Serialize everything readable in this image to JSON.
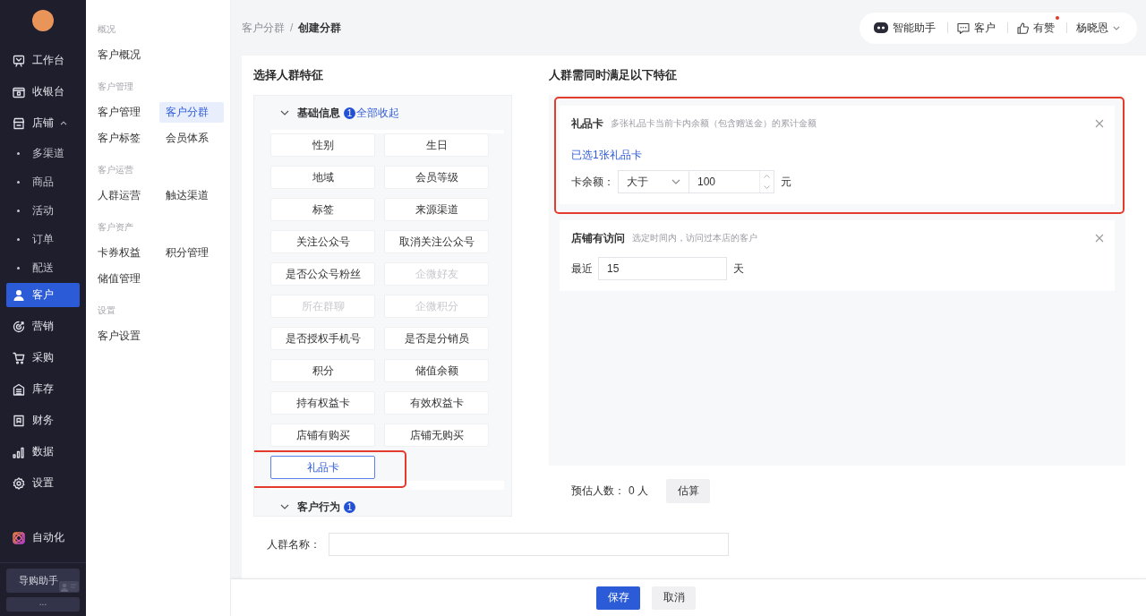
{
  "sidebar": {
    "items": [
      {
        "label": "工作台",
        "selected": false
      },
      {
        "label": "收银台",
        "selected": false
      },
      {
        "label": "店铺",
        "selected": false,
        "expanded": true,
        "children": [
          {
            "label": "多渠道",
            "selected": false
          },
          {
            "label": "商品",
            "selected": false
          },
          {
            "label": "活动",
            "selected": false
          },
          {
            "label": "订单",
            "selected": false
          },
          {
            "label": "配送",
            "selected": false
          }
        ]
      },
      {
        "label": "客户",
        "selected": true
      },
      {
        "label": "营销",
        "selected": false
      },
      {
        "label": "采购",
        "selected": false
      },
      {
        "label": "库存",
        "selected": false
      },
      {
        "label": "财务",
        "selected": false
      },
      {
        "label": "数据",
        "selected": false
      },
      {
        "label": "设置",
        "selected": false
      }
    ],
    "automation": {
      "label": "自动化"
    },
    "assistant_button": "导购助手",
    "more_button": "..."
  },
  "subnav": {
    "sections": [
      {
        "heading": "概况",
        "items": [
          {
            "label": "客户概况",
            "selected": false
          }
        ]
      },
      {
        "heading": "客户管理",
        "items": [
          {
            "label": "客户管理",
            "selected": false
          },
          {
            "label": "客户分群",
            "selected": true
          },
          {
            "label": "客户标签",
            "selected": false
          },
          {
            "label": "会员体系",
            "selected": false
          }
        ]
      },
      {
        "heading": "客户运营",
        "items": [
          {
            "label": "人群运营",
            "selected": false
          },
          {
            "label": "触达渠道",
            "selected": false
          }
        ]
      },
      {
        "heading": "客户资产",
        "items": [
          {
            "label": "卡券权益",
            "selected": false
          },
          {
            "label": "积分管理",
            "selected": false
          },
          {
            "label": "储值管理",
            "selected": false
          }
        ]
      },
      {
        "heading": "设置",
        "items": [
          {
            "label": "客户设置",
            "selected": false
          }
        ]
      }
    ]
  },
  "breadcrumb": {
    "items": [
      "客户分群",
      "创建分群"
    ],
    "separator": "/"
  },
  "topbar": {
    "items": [
      {
        "kind": "assistant",
        "label": "智能助手",
        "badge_dot": false
      },
      {
        "kind": "message",
        "label": "客户",
        "badge_dot": false
      },
      {
        "kind": "like",
        "label": "有赞",
        "badge_dot": true
      },
      {
        "kind": "user",
        "label": "杨晓恩",
        "badge_dot": false
      }
    ]
  },
  "feature_picker": {
    "title": "选择人群特征",
    "groups": [
      {
        "label": "基础信息",
        "count": "1",
        "action": "全部收起",
        "options": [
          {
            "label": "性别",
            "selected": false,
            "disabled": false,
            "highlighted": false
          },
          {
            "label": "生日",
            "selected": false,
            "disabled": false,
            "highlighted": false
          },
          {
            "label": "地域",
            "selected": false,
            "disabled": false,
            "highlighted": false
          },
          {
            "label": "会员等级",
            "selected": false,
            "disabled": false,
            "highlighted": false
          },
          {
            "label": "标签",
            "selected": false,
            "disabled": false,
            "highlighted": false
          },
          {
            "label": "来源渠道",
            "selected": false,
            "disabled": false,
            "highlighted": false
          },
          {
            "label": "关注公众号",
            "selected": false,
            "disabled": false,
            "highlighted": false
          },
          {
            "label": "取消关注公众号",
            "selected": false,
            "disabled": false,
            "highlighted": false
          },
          {
            "label": "是否公众号粉丝",
            "selected": false,
            "disabled": false,
            "highlighted": false
          },
          {
            "label": "企微好友",
            "selected": false,
            "disabled": true,
            "highlighted": false
          },
          {
            "label": "所在群聊",
            "selected": false,
            "disabled": true,
            "highlighted": false
          },
          {
            "label": "企微积分",
            "selected": false,
            "disabled": true,
            "highlighted": false
          },
          {
            "label": "是否授权手机号",
            "selected": false,
            "disabled": false,
            "highlighted": false
          },
          {
            "label": "是否是分销员",
            "selected": false,
            "disabled": false,
            "highlighted": false
          },
          {
            "label": "积分",
            "selected": false,
            "disabled": false,
            "highlighted": false
          },
          {
            "label": "储值余额",
            "selected": false,
            "disabled": false,
            "highlighted": false
          },
          {
            "label": "持有权益卡",
            "selected": false,
            "disabled": false,
            "highlighted": false
          },
          {
            "label": "有效权益卡",
            "selected": false,
            "disabled": false,
            "highlighted": false
          },
          {
            "label": "店铺有购买",
            "selected": false,
            "disabled": false,
            "highlighted": false
          },
          {
            "label": "店铺无购买",
            "selected": false,
            "disabled": false,
            "highlighted": false
          },
          {
            "label": "礼品卡",
            "selected": true,
            "disabled": false,
            "highlighted": true
          }
        ]
      },
      {
        "label": "客户行为",
        "count": "1"
      }
    ]
  },
  "conditions": {
    "title": "人群需同时满足以下特征",
    "items": [
      {
        "kind": "select_number",
        "title": "礼品卡",
        "description": "多张礼品卡当前卡内余额（包含赠送金）的累计金额",
        "highlighted": true,
        "link": "已选1张礼品卡",
        "label": "卡余额：",
        "operator": "大于",
        "value": "100",
        "unit": "元"
      },
      {
        "kind": "number",
        "title": "店铺有访问",
        "description": "选定时间内，访问过本店的客户",
        "highlighted": false,
        "label": "最近",
        "value": "15",
        "unit": "天"
      }
    ]
  },
  "estimate": {
    "label": "预估人数：",
    "value": "0 人",
    "button": "估算"
  },
  "name_field": {
    "label": "人群名称："
  },
  "footer": {
    "buttons": [
      {
        "label": "保存",
        "kind": "primary"
      },
      {
        "label": "取消",
        "kind": "default"
      }
    ]
  }
}
